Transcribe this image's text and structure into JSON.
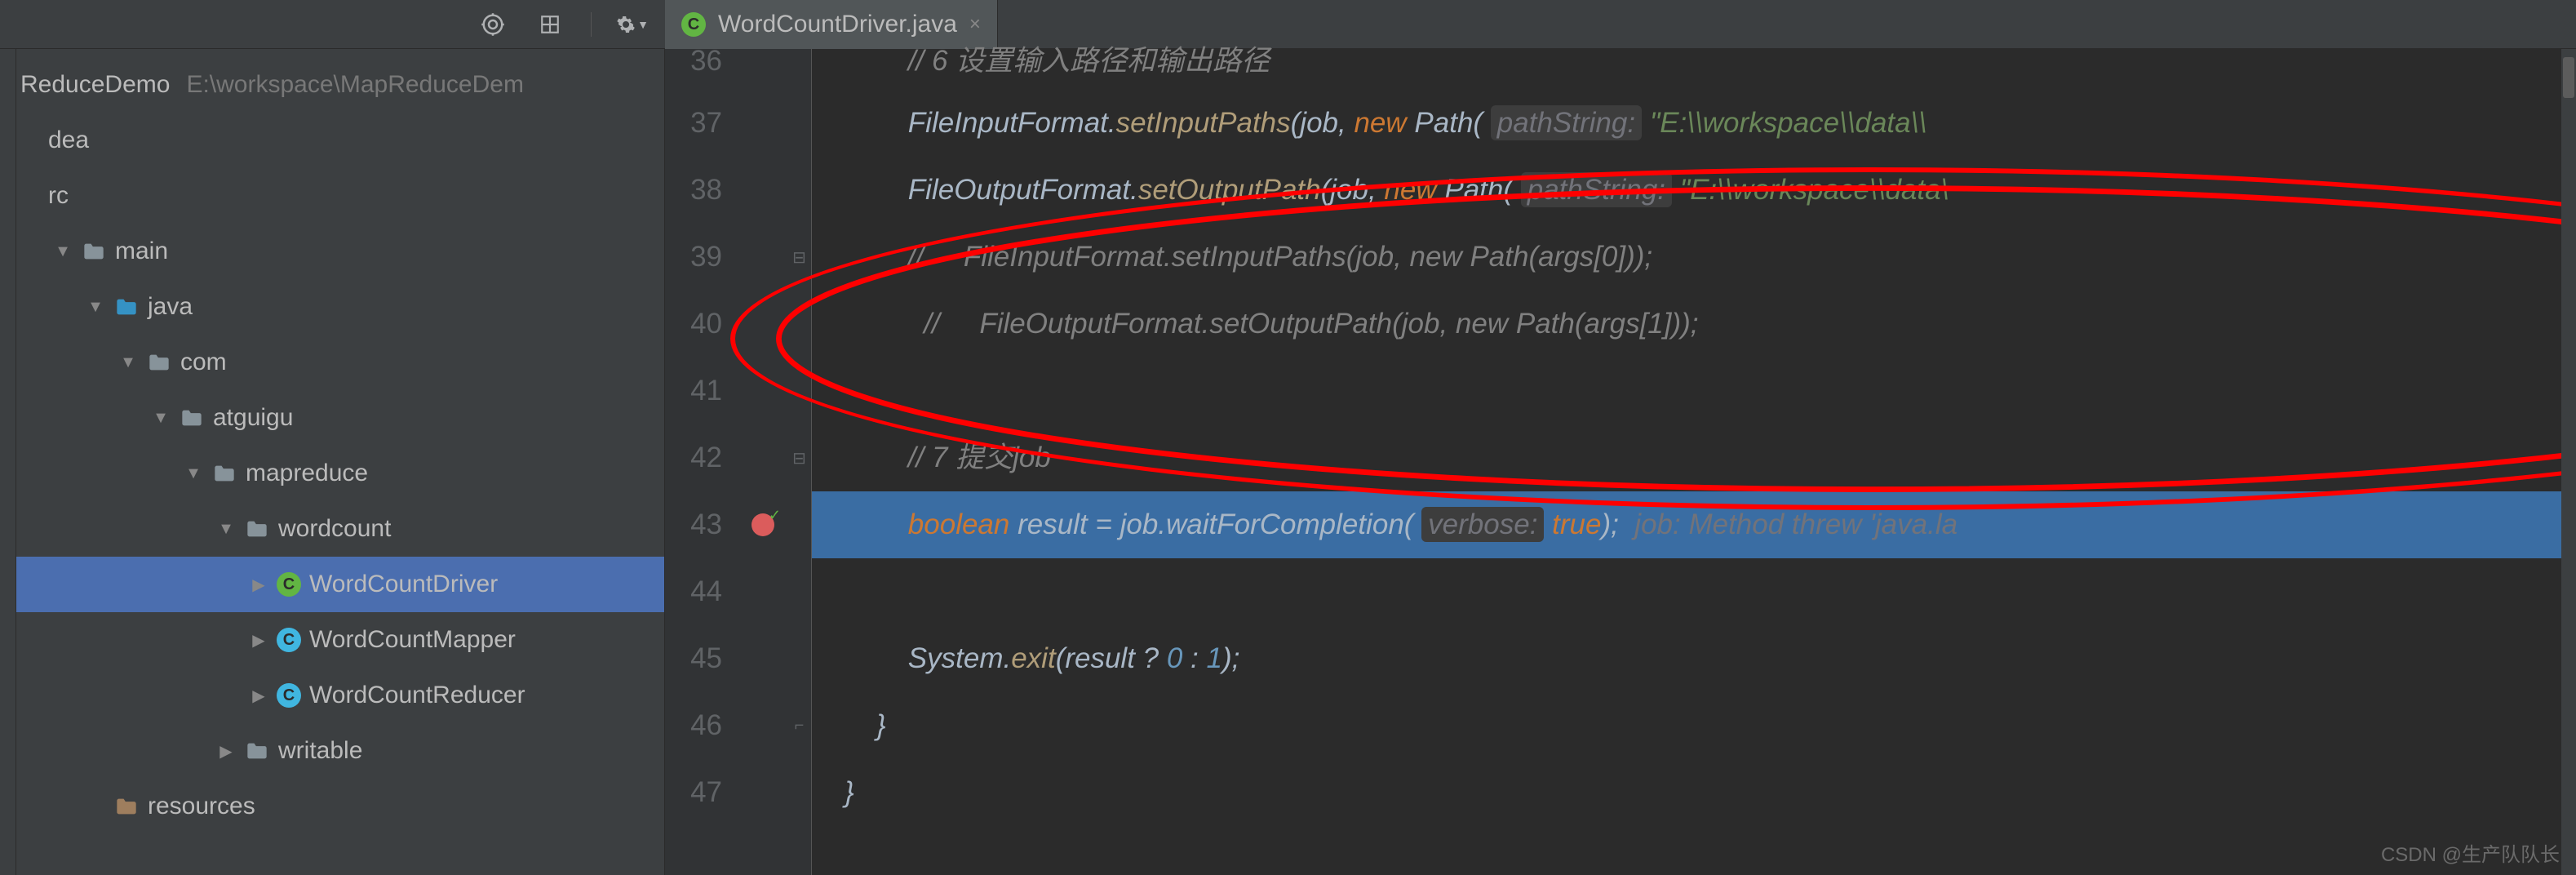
{
  "toolbar": {
    "icons": [
      "target-icon",
      "expand-icon",
      "gear-icon"
    ]
  },
  "tree": {
    "root_name": "ReduceDemo",
    "root_path": "E:\\workspace\\MapReduceDem",
    "items": [
      {
        "label": "dea",
        "indent": 1,
        "arrow": "",
        "icon": "none"
      },
      {
        "label": "rc",
        "indent": 1,
        "arrow": "",
        "icon": "none"
      },
      {
        "label": "main",
        "indent": 2,
        "arrow": "▼",
        "icon": "folder"
      },
      {
        "label": "java",
        "indent": 3,
        "arrow": "▼",
        "icon": "folder-blue"
      },
      {
        "label": "com",
        "indent": 4,
        "arrow": "▼",
        "icon": "folder-grey"
      },
      {
        "label": "atguigu",
        "indent": 5,
        "arrow": "▼",
        "icon": "folder-grey"
      },
      {
        "label": "mapreduce",
        "indent": 6,
        "arrow": "▼",
        "icon": "folder-grey"
      },
      {
        "label": "wordcount",
        "indent": 7,
        "arrow": "▼",
        "icon": "folder-grey"
      },
      {
        "label": "WordCountDriver",
        "indent": 8,
        "arrow": "▶",
        "icon": "class-green",
        "selected": true
      },
      {
        "label": "WordCountMapper",
        "indent": 8,
        "arrow": "▶",
        "icon": "class-blue"
      },
      {
        "label": "WordCountReducer",
        "indent": 8,
        "arrow": "▶",
        "icon": "class-blue"
      },
      {
        "label": "writable",
        "indent": 7,
        "arrow": "▶",
        "icon": "folder-grey"
      },
      {
        "label": "resources",
        "indent": 3,
        "arrow": "",
        "icon": "folder-res"
      }
    ]
  },
  "tab": {
    "name": "WordCountDriver.java"
  },
  "code": {
    "lines": [
      {
        "num": "36",
        "tokens": [
          [
            "comment",
            "// 6 设置输入路径和输出路径"
          ]
        ],
        "partial": true
      },
      {
        "num": "37",
        "tokens": [
          [
            "plain",
            "FileInputFormat."
          ],
          [
            "methoditalic",
            "setInputPaths"
          ],
          [
            "plain",
            "(job, "
          ],
          [
            "keyword",
            "new"
          ],
          [
            "plain",
            " Path( "
          ],
          [
            "param",
            "pathString:"
          ],
          [
            "plain",
            " "
          ],
          [
            "string",
            "\"E:\\\\workspace\\\\data\\\\"
          ]
        ]
      },
      {
        "num": "38",
        "tokens": [
          [
            "plain",
            "FileOutputFormat."
          ],
          [
            "methoditalic",
            "setOutputPath"
          ],
          [
            "plain",
            "(job, "
          ],
          [
            "keyword",
            "new"
          ],
          [
            "plain",
            " Path( "
          ],
          [
            "param",
            "pathString:"
          ],
          [
            "plain",
            " "
          ],
          [
            "string",
            "\"E:\\\\workspace\\\\data\\"
          ]
        ]
      },
      {
        "num": "39",
        "tokens": [
          [
            "comment",
            "//     FileInputFormat.setInputPaths(job, new Path(args[0]));"
          ]
        ],
        "fold": true
      },
      {
        "num": "40",
        "tokens": [
          [
            "comment",
            "  //     FileOutputFormat.setOutputPath(job, new Path(args[1]));"
          ]
        ]
      },
      {
        "num": "41",
        "tokens": []
      },
      {
        "num": "42",
        "tokens": [
          [
            "comment",
            "// 7 提交job"
          ]
        ],
        "fold": true
      },
      {
        "num": "43",
        "tokens": [
          [
            "keyword",
            "boolean"
          ],
          [
            "plain",
            " result = job.waitForCompletion( "
          ],
          [
            "param",
            "verbose:"
          ],
          [
            "plain",
            " "
          ],
          [
            "keyword",
            "true"
          ],
          [
            "plain",
            ");  "
          ],
          [
            "inlinehint",
            "job: Method threw 'java.la"
          ]
        ],
        "highlighted": true,
        "breakpoint": true
      },
      {
        "num": "44",
        "tokens": []
      },
      {
        "num": "45",
        "tokens": [
          [
            "plain",
            "System."
          ],
          [
            "methoditalic",
            "exit"
          ],
          [
            "plain",
            "(result ? "
          ],
          [
            "number",
            "0"
          ],
          [
            "plain",
            " : "
          ],
          [
            "number",
            "1"
          ],
          [
            "plain",
            ");"
          ]
        ]
      },
      {
        "num": "46",
        "tokens": [
          [
            "plain",
            "}"
          ]
        ],
        "indent_less": 1,
        "fold": "close"
      },
      {
        "num": "47",
        "tokens": [
          [
            "plain",
            "}"
          ]
        ],
        "indent_less": 2
      }
    ]
  },
  "watermark": "CSDN @生产队队长"
}
